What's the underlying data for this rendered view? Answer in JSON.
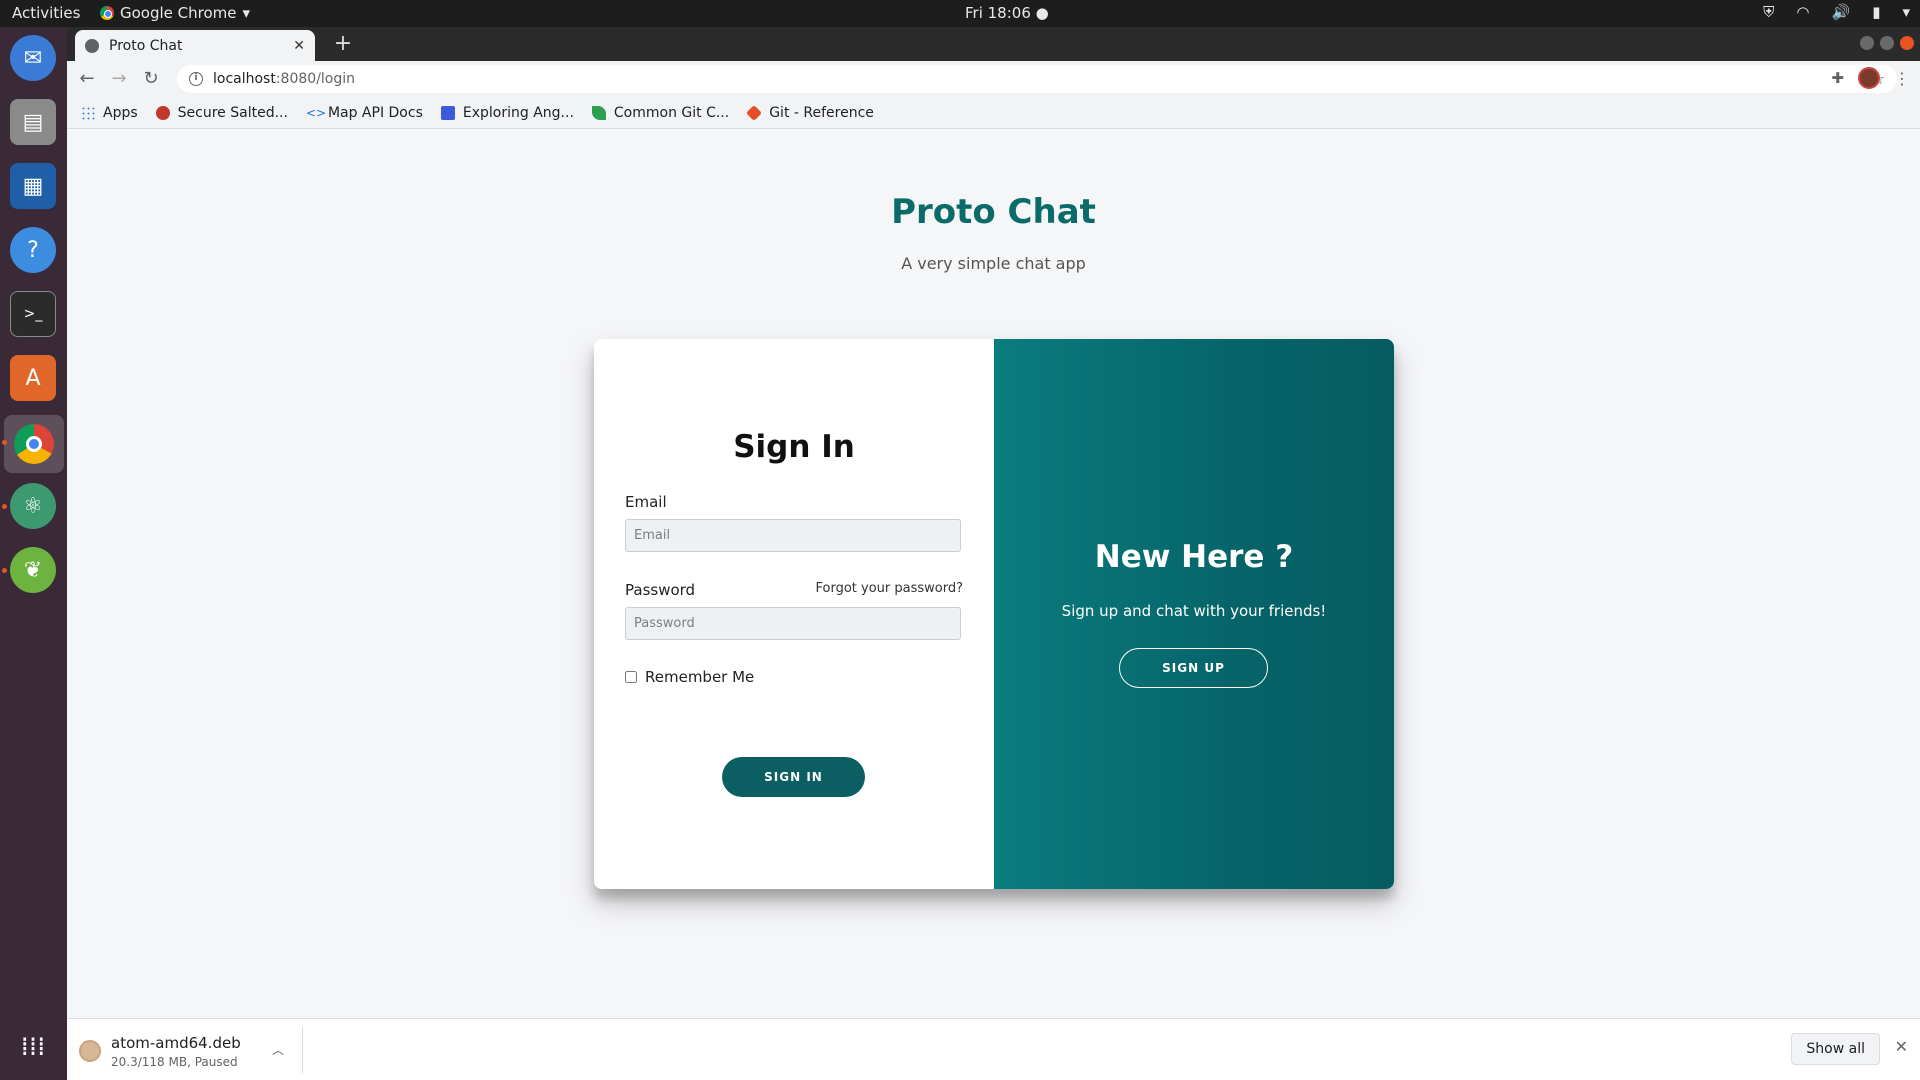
{
  "topbar": {
    "activities": "Activities",
    "app_menu": "Google Chrome",
    "clock": "Fri 18:06"
  },
  "dock": {
    "items": [
      "thunderbird-icon",
      "files-icon",
      "writer-icon",
      "help-icon",
      "terminal-icon",
      "software-icon",
      "chrome-icon",
      "atom-icon",
      "spring-icon",
      "apps-grid-icon"
    ]
  },
  "browser": {
    "tab_title": "Proto Chat",
    "url_host": "localhost",
    "url_path": ":8080/login",
    "bookmarks": [
      {
        "label": "Apps",
        "color": "#4285f4"
      },
      {
        "label": "Secure Salted...",
        "color": "#c0392b"
      },
      {
        "label": "Map API Docs",
        "color": "#1a73e8"
      },
      {
        "label": "Exploring Ang...",
        "color": "#3b5bdb"
      },
      {
        "label": "Common Git C...",
        "color": "#2e9e4f"
      },
      {
        "label": "Git - Reference",
        "color": "#e44d26"
      }
    ]
  },
  "page": {
    "title": "Proto Chat",
    "subtitle": "A very simple chat app",
    "signin": {
      "heading": "Sign In",
      "email_label": "Email",
      "email_placeholder": "Email",
      "password_label": "Password",
      "password_placeholder": "Password",
      "forgot": "Forgot your password?",
      "remember": "Remember Me",
      "button": "SIGN IN"
    },
    "signup": {
      "heading": "New Here ?",
      "text": "Sign up and chat with your friends!",
      "button": "SIGN UP"
    }
  },
  "downloads": {
    "file": "atom-amd64.deb",
    "status": "20.3/118 MB, Paused",
    "show_all": "Show all"
  },
  "colors": {
    "brand": "#0b6b6b",
    "panel": "#066469"
  }
}
